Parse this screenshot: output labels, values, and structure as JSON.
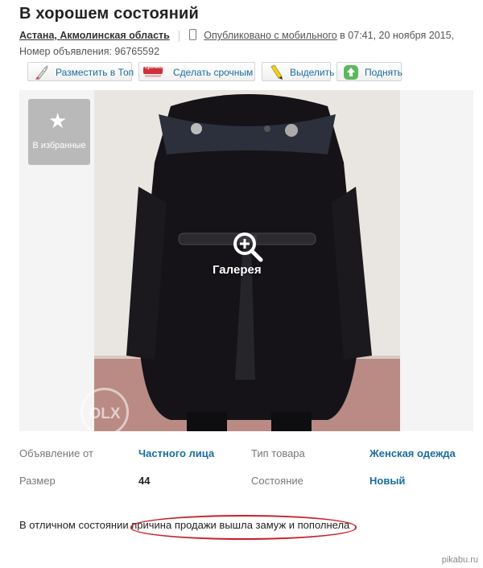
{
  "ad": {
    "title": "В хорошем состояний",
    "location": "Астана, Акмолинская область",
    "published": "Опубликовано с мобильного",
    "published_time": "в 07:41, 20 ноября 2015,",
    "ad_number": "Номер объявления: 96765592"
  },
  "toolbar": {
    "top_label": "Разместить в Топ",
    "urgent_label": "Сделать срочным",
    "urgent_badge": "срочно",
    "highlight_label": "Выделить",
    "raise_label": "Поднять"
  },
  "gallery": {
    "favorite_label": "В избранные",
    "gallery_label": "Галерея",
    "watermark": "OLX"
  },
  "params": [
    {
      "key": "Объявление от",
      "value": "Частного лица"
    },
    {
      "key": "Тип товара",
      "value": "Женская одежда"
    },
    {
      "key": "Размер",
      "value": "44"
    },
    {
      "key": "Состояние",
      "value": "Новый"
    }
  ],
  "description": {
    "text": "В отличном состоянии причина продажи вышла замуж и пополнела"
  },
  "site_watermark": "pikabu.ru",
  "colors": {
    "link": "#1a6e9e",
    "highlight_circle": "#c8222a"
  }
}
